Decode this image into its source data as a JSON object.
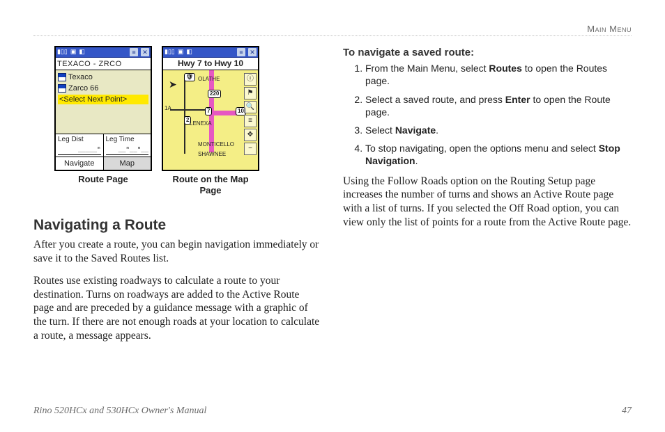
{
  "runningHead": "Main Menu",
  "figures": {
    "routePage": {
      "title": "TEXACO - ZRCO",
      "items": [
        "Texaco",
        "Zarco 66"
      ],
      "selectNext": "<Select Next Point>",
      "legDistLabel": "Leg Dist",
      "legDistValue": "_____ᵐ",
      "legTimeLabel": "Leg Time",
      "legTimeValue": "__ᵐ__ᵐ__",
      "tabNavigate": "Navigate",
      "tabMap": "Map",
      "caption": "Route Page"
    },
    "mapPage": {
      "title": "Hwy 7 to Hwy 10",
      "cities": {
        "olathe": "OLATHE",
        "lenexa": "LENEXA",
        "monticello": "MONTICELLO",
        "shawnee": "SHAWNEE"
      },
      "shields": {
        "a": "1A",
        "s220": "220",
        "s7": "7",
        "s10": "10",
        "s2": "2"
      },
      "caption": "Route on the Map Page"
    }
  },
  "leftCol": {
    "heading": "Navigating a Route",
    "p1": "After you create a route, you can begin navigation immediately or save it to the Saved Routes list.",
    "p2": "Routes use existing roadways to calculate a route to your destination. Turns on roadways are added to the Active Route page and are preceded by a guidance message with a graphic of the turn. If there are not enough roads at your location to calculate a route, a message appears."
  },
  "rightCol": {
    "procHead": "To navigate a saved route:",
    "steps": {
      "s1a": "From the Main Menu, select ",
      "s1b": "Routes",
      "s1c": " to open the Routes page.",
      "s2a": "Select a saved route, and press ",
      "s2b": "Enter",
      "s2c": " to open the Route page.",
      "s3a": "Select ",
      "s3b": "Navigate",
      "s3c": ".",
      "s4a": "To stop navigating, open the options menu and select ",
      "s4b": "Stop Navigation",
      "s4c": "."
    },
    "p1": "Using the Follow Roads option on the Routing Setup page increases the number of turns and shows an Active Route page with a list of turns. If you selected the Off Road option, you can view only the list of points for a route from the Active Route page."
  },
  "footer": {
    "left": "Rino 520HCx and 530HCx Owner's Manual",
    "page": "47"
  }
}
